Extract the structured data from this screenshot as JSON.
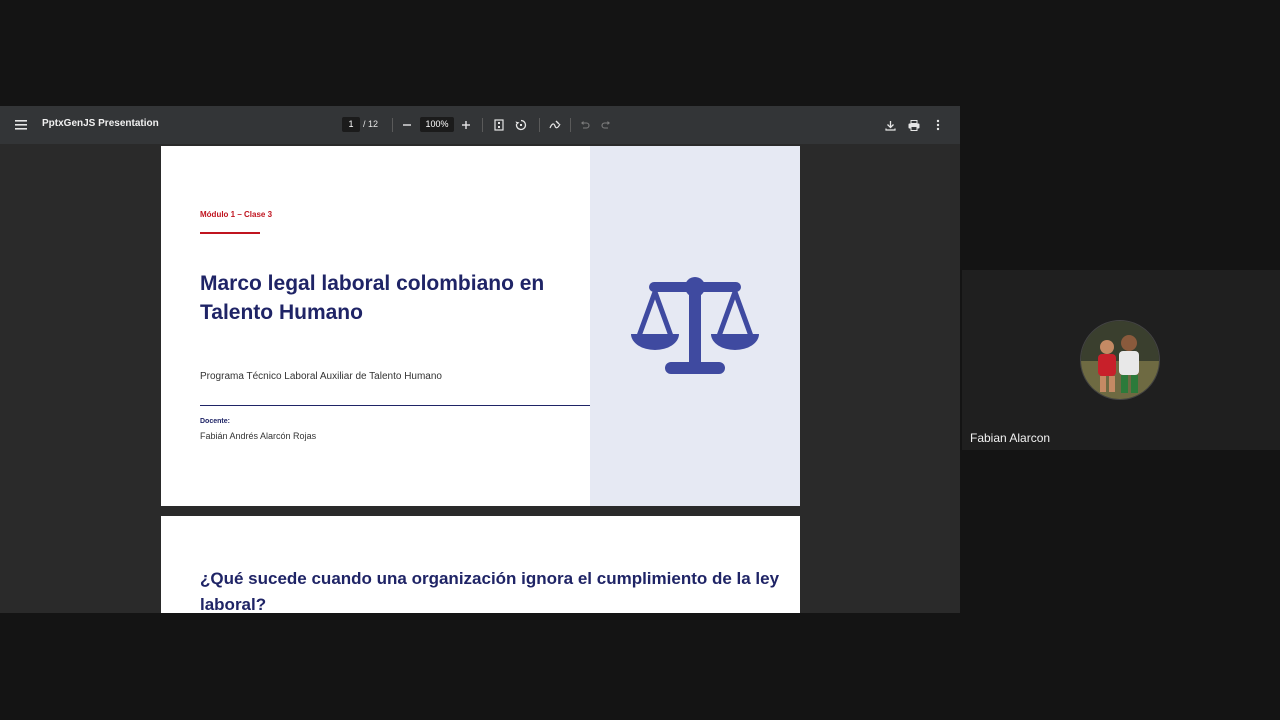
{
  "viewer": {
    "doc_title": "PptxGenJS Presentation",
    "current_page": "1",
    "total_pages": "/ 12",
    "zoom": "100%"
  },
  "slide1": {
    "module": "Módulo 1 – Clase 3",
    "title": "Marco legal laboral colombiano en Talento Humano",
    "program": "Programa Técnico Laboral Auxiliar de Talento Humano",
    "docente_label": "Docente:",
    "docente_name": "Fabián Andrés Alarcón Rojas",
    "accent_color": "#c0141f",
    "title_color": "#1f2466",
    "icon_color": "#3f4aa0",
    "sidebar_color": "#e6e9f3"
  },
  "slide2": {
    "title": "¿Qué sucede cuando una organización ignora el cumplimiento de la ley laboral?"
  },
  "participant": {
    "name": "Fabian Alarcon"
  },
  "icons": {
    "menu": "menu-icon",
    "zoom_out": "minus-icon",
    "zoom_in": "plus-icon",
    "fit": "fit-page-icon",
    "rotate": "rotate-icon",
    "annotate": "draw-icon",
    "undo": "undo-icon",
    "redo": "redo-icon",
    "download": "download-icon",
    "print": "print-icon",
    "more": "more-vertical-icon",
    "scale": "scale-justice-icon"
  }
}
